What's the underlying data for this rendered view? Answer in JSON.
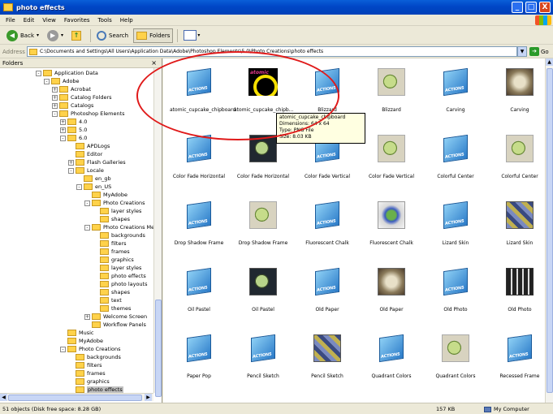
{
  "window": {
    "title": "photo effects",
    "buttons": {
      "minimize": "_",
      "maximize": "□",
      "close": "X"
    }
  },
  "menu": [
    "File",
    "Edit",
    "View",
    "Favorites",
    "Tools",
    "Help"
  ],
  "toolbar": {
    "back": "Back",
    "search": "Search",
    "folders": "Folders"
  },
  "address": {
    "label": "Address",
    "path": "C:\\Documents and Settings\\All Users\\Application Data\\Adobe\\Photoshop Elements\\5.0\\Photo Creations\\photo effects",
    "go": "Go"
  },
  "folders_pane": {
    "title": "Folders",
    "items": [
      {
        "label": "Application Data",
        "depth": 0,
        "exp": "-"
      },
      {
        "label": "Adobe",
        "depth": 1,
        "exp": "-"
      },
      {
        "label": "Acrobat",
        "depth": 2,
        "exp": "+"
      },
      {
        "label": "Catalog Folders",
        "depth": 2,
        "exp": "+"
      },
      {
        "label": "Catalogs",
        "depth": 2,
        "exp": "+"
      },
      {
        "label": "Photoshop Elements",
        "depth": 2,
        "exp": "-"
      },
      {
        "label": "4.0",
        "depth": 3,
        "exp": "+"
      },
      {
        "label": "5.0",
        "depth": 3,
        "exp": "+"
      },
      {
        "label": "6.0",
        "depth": 3,
        "exp": "-"
      },
      {
        "label": "APDLogs",
        "depth": 4,
        "exp": ""
      },
      {
        "label": "Editor",
        "depth": 4,
        "exp": ""
      },
      {
        "label": "Flash Galleries",
        "depth": 4,
        "exp": "+"
      },
      {
        "label": "Locale",
        "depth": 4,
        "exp": "-"
      },
      {
        "label": "en_gb",
        "depth": 5,
        "exp": ""
      },
      {
        "label": "en_US",
        "depth": 5,
        "exp": "-"
      },
      {
        "label": "MyAdobe",
        "depth": 6,
        "exp": ""
      },
      {
        "label": "Photo Creations",
        "depth": 6,
        "exp": "-"
      },
      {
        "label": "layer styles",
        "depth": 7,
        "exp": ""
      },
      {
        "label": "shapes",
        "depth": 7,
        "exp": ""
      },
      {
        "label": "Photo Creations Me",
        "depth": 6,
        "exp": "-"
      },
      {
        "label": "backgrounds",
        "depth": 7,
        "exp": ""
      },
      {
        "label": "filters",
        "depth": 7,
        "exp": ""
      },
      {
        "label": "frames",
        "depth": 7,
        "exp": ""
      },
      {
        "label": "graphics",
        "depth": 7,
        "exp": ""
      },
      {
        "label": "layer styles",
        "depth": 7,
        "exp": ""
      },
      {
        "label": "photo effects",
        "depth": 7,
        "exp": ""
      },
      {
        "label": "photo layouts",
        "depth": 7,
        "exp": ""
      },
      {
        "label": "shapes",
        "depth": 7,
        "exp": ""
      },
      {
        "label": "text",
        "depth": 7,
        "exp": ""
      },
      {
        "label": "themes",
        "depth": 7,
        "exp": ""
      },
      {
        "label": "Welcome Screen",
        "depth": 6,
        "exp": "+"
      },
      {
        "label": "Workflow Panels",
        "depth": 6,
        "exp": ""
      },
      {
        "label": "Music",
        "depth": 3,
        "exp": ""
      },
      {
        "label": "MyAdobe",
        "depth": 3,
        "exp": ""
      },
      {
        "label": "Photo Creations",
        "depth": 3,
        "exp": "-"
      },
      {
        "label": "backgrounds",
        "depth": 4,
        "exp": ""
      },
      {
        "label": "filters",
        "depth": 4,
        "exp": ""
      },
      {
        "label": "frames",
        "depth": 4,
        "exp": ""
      },
      {
        "label": "graphics",
        "depth": 4,
        "exp": ""
      },
      {
        "label": "photo effects",
        "depth": 4,
        "exp": "",
        "selected": true
      }
    ]
  },
  "files": [
    {
      "name": "atomic_cupcake_chipboard",
      "thumb": "actions"
    },
    {
      "name": "atomic_cupcake_chipb...",
      "thumb": "cupcake"
    },
    {
      "name": "Blizzard",
      "thumb": "actions"
    },
    {
      "name": "Blizzard",
      "thumb": "apple"
    },
    {
      "name": "Carving",
      "thumb": "actions"
    },
    {
      "name": "Carving",
      "thumb": "sepia"
    },
    {
      "name": "Color Fade Horizontal",
      "thumb": "actions"
    },
    {
      "name": "Color Fade Horizontal",
      "thumb": "apple-dark"
    },
    {
      "name": "Color Fade Vertical",
      "thumb": "actions"
    },
    {
      "name": "Color Fade Vertical",
      "thumb": "apple"
    },
    {
      "name": "Colorful Center",
      "thumb": "actions"
    },
    {
      "name": "Colorful Center",
      "thumb": "apple"
    },
    {
      "name": "Drop Shadow Frame",
      "thumb": "actions"
    },
    {
      "name": "Drop Shadow Frame",
      "thumb": "apple"
    },
    {
      "name": "Fluorescent Chalk",
      "thumb": "actions"
    },
    {
      "name": "Fluorescent Chalk",
      "thumb": "splat"
    },
    {
      "name": "Lizard Skin",
      "thumb": "actions"
    },
    {
      "name": "Lizard Skin",
      "thumb": "mosaic"
    },
    {
      "name": "Oil Pastel",
      "thumb": "actions"
    },
    {
      "name": "Oil Pastel",
      "thumb": "apple-dark"
    },
    {
      "name": "Old Paper",
      "thumb": "actions"
    },
    {
      "name": "Old Paper",
      "thumb": "sepia"
    },
    {
      "name": "Old Photo",
      "thumb": "actions"
    },
    {
      "name": "Old Photo",
      "thumb": "grid"
    },
    {
      "name": "Paper Pop",
      "thumb": "actions"
    },
    {
      "name": "Pencil Sketch",
      "thumb": "actions"
    },
    {
      "name": "Pencil Sketch",
      "thumb": "mosaic"
    },
    {
      "name": "Quadrant Colors",
      "thumb": "actions"
    },
    {
      "name": "Quadrant Colors",
      "thumb": "apple"
    },
    {
      "name": "Recessed Frame",
      "thumb": "actions"
    }
  ],
  "actions_badge": "ACTIONS",
  "cupcake_badge": "atomic",
  "tooltip": {
    "lines": [
      "atomic_cupcake_chipboard",
      "Dimensions: 64 x 64",
      "Type: PNG File",
      "Size: 8.03 KB"
    ]
  },
  "status": {
    "objects": "51 objects (Disk free space: 8.28 GB)",
    "size": "157 KB",
    "location": "My Computer"
  }
}
